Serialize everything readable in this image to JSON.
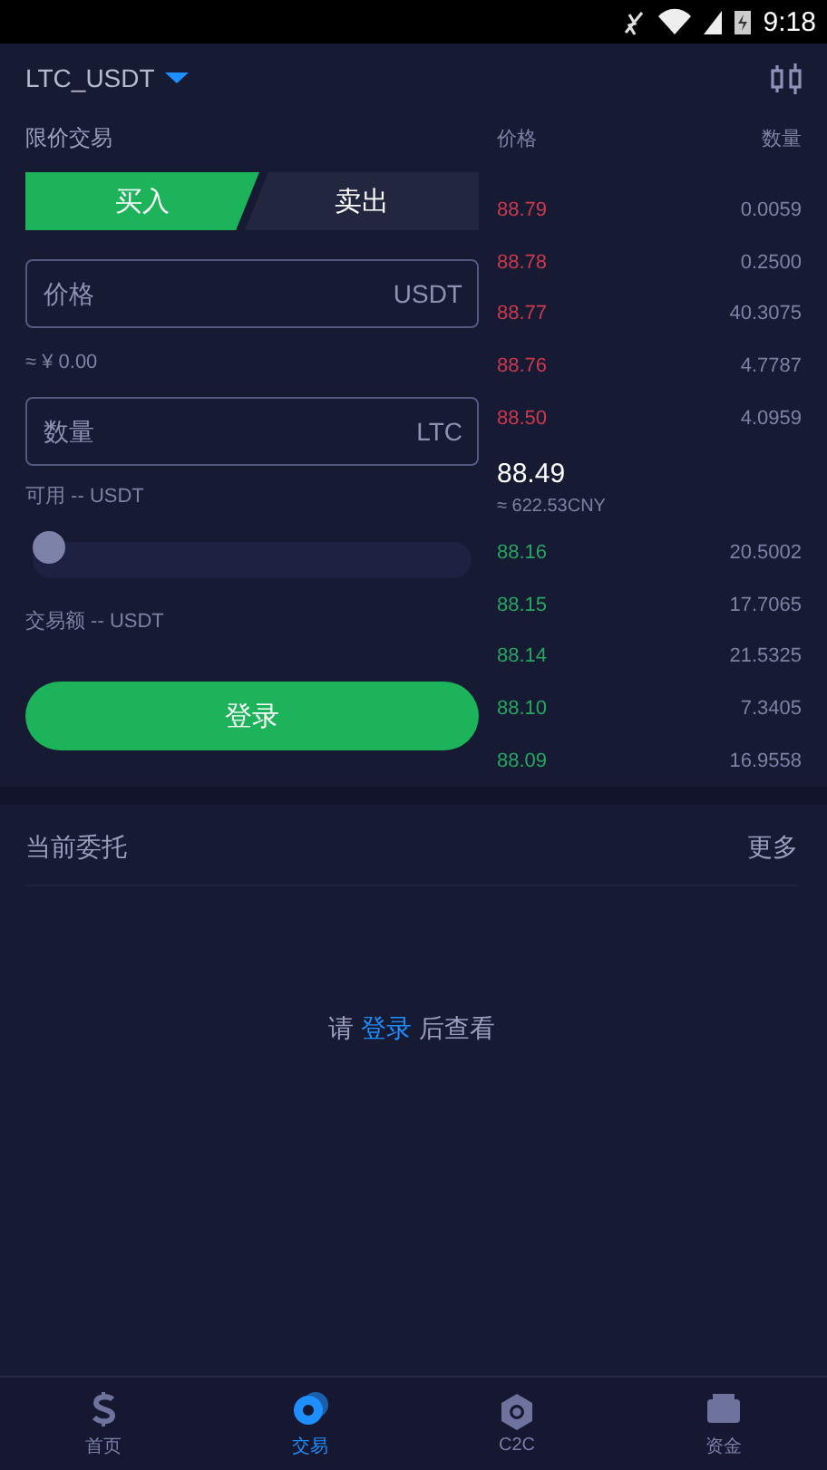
{
  "status_bar": {
    "time": "9:18"
  },
  "header": {
    "pair": "LTC_USDT"
  },
  "trade": {
    "title": "限价交易",
    "tabs": [
      {
        "label": "买入",
        "selected": true
      },
      {
        "label": "卖出",
        "selected": false
      }
    ],
    "price_field": {
      "placeholder": "价格",
      "unit": "USDT"
    },
    "price_estimate": "≈ ¥ 0.00",
    "amount_field": {
      "placeholder": "数量",
      "unit": "LTC"
    },
    "available": "可用 -- USDT",
    "slider": {
      "level": 0
    },
    "total": "交易额 -- USDT",
    "login_button": "登录"
  },
  "order_book": {
    "columns": [
      "价格",
      "数量"
    ],
    "asks": [
      {
        "price": "88.79",
        "amount": "0.0059"
      },
      {
        "price": "88.78",
        "amount": "0.2500"
      },
      {
        "price": "88.77",
        "amount": "40.3075"
      },
      {
        "price": "88.76",
        "amount": "4.7787"
      },
      {
        "price": "88.50",
        "amount": "4.0959"
      }
    ],
    "last_price": "88.49",
    "last_price_cny": "≈ 622.53CNY",
    "bids": [
      {
        "price": "88.16",
        "amount": "20.5002"
      },
      {
        "price": "88.15",
        "amount": "17.7065"
      },
      {
        "price": "88.14",
        "amount": "21.5325"
      },
      {
        "price": "88.10",
        "amount": "7.3405"
      },
      {
        "price": "88.09",
        "amount": "16.9558"
      }
    ]
  },
  "orders": {
    "title": "当前委托",
    "more": "更多",
    "empty": {
      "before": "请",
      "link": "登录",
      "after": "后查看"
    }
  },
  "nav": [
    {
      "label": "首页",
      "kind": "dollar",
      "selected": false
    },
    {
      "label": "交易",
      "kind": "coins",
      "selected": true
    },
    {
      "label": "C2C",
      "kind": "hexagon",
      "selected": false
    },
    {
      "label": "资金",
      "kind": "wallet",
      "selected": false
    }
  ]
}
